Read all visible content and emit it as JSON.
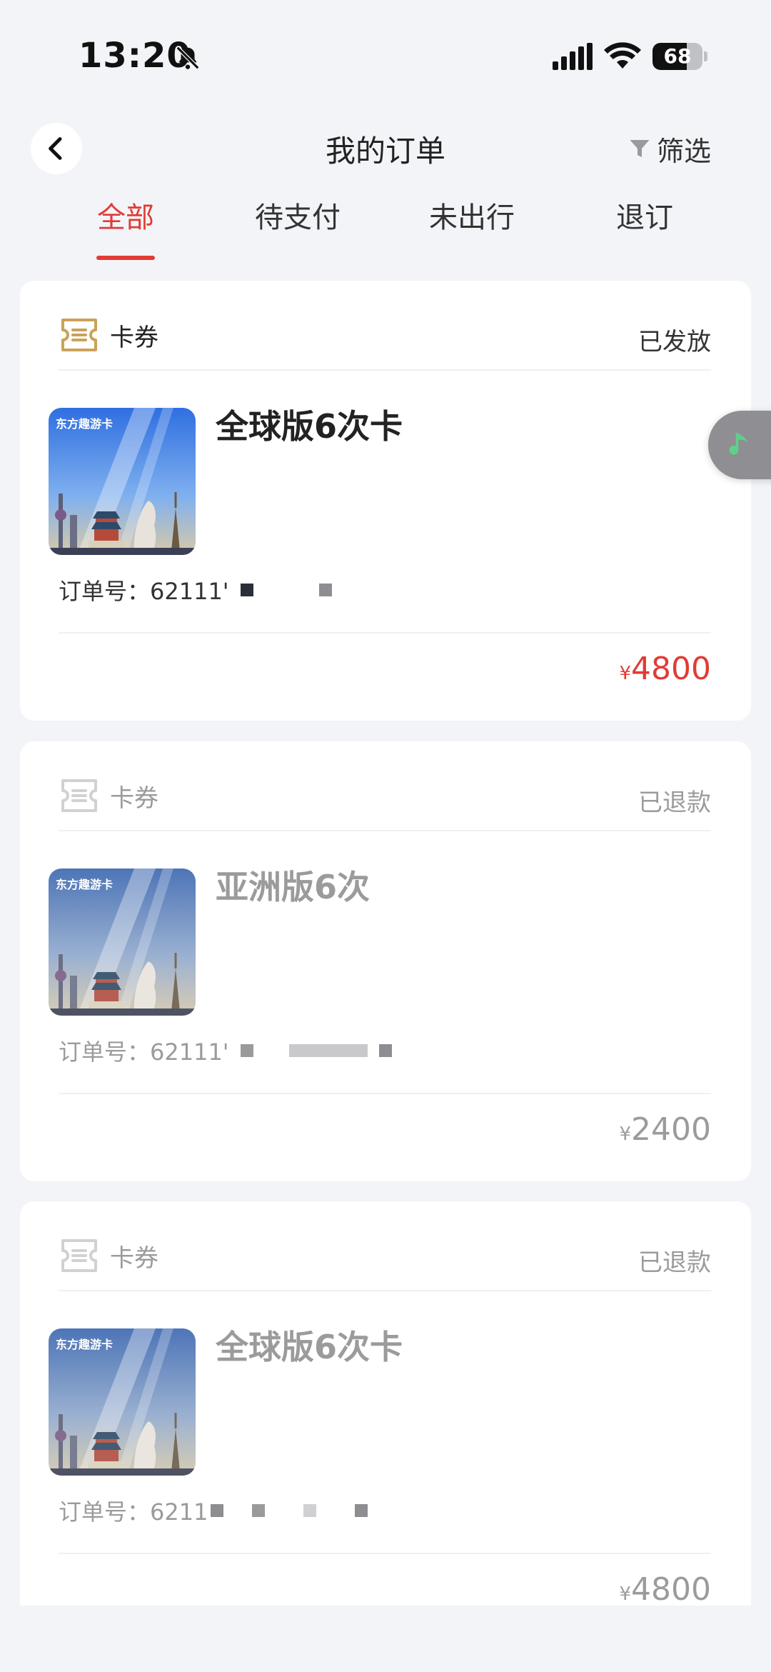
{
  "status_bar": {
    "time": "13:20",
    "battery": "68",
    "battery_level": 0.68
  },
  "header": {
    "title": "我的订单",
    "filter_label": "筛选"
  },
  "tabs": [
    {
      "label": "全部",
      "active": true
    },
    {
      "label": "待支付",
      "active": false
    },
    {
      "label": "未出行",
      "active": false
    },
    {
      "label": "退订",
      "active": false
    }
  ],
  "orders": [
    {
      "category": "卡券",
      "status": "已发放",
      "thumb_label": "东方趣游卡",
      "name": "全球版6次卡",
      "order_no": "订单号：62111'",
      "currency": "¥",
      "price": "4800"
    },
    {
      "category": "卡券",
      "status": "已退款",
      "thumb_label": "东方趣游卡",
      "name": "亚洲版6次",
      "order_no": "订单号：62111'",
      "currency": "¥",
      "price": "2400"
    },
    {
      "category": "卡券",
      "status": "已退款",
      "thumb_label": "东方趣游卡",
      "name": "全球版6次卡",
      "order_no": "订单号：6211",
      "currency": "¥",
      "price": "4800"
    }
  ],
  "icons": {
    "back": "chevron-left-icon",
    "filter": "funnel-icon",
    "ticket": "ticket-icon",
    "music": "music-note-icon"
  },
  "colors": {
    "accent": "#e23b35",
    "background": "#f3f4f8",
    "music": "#5fcf8a"
  }
}
